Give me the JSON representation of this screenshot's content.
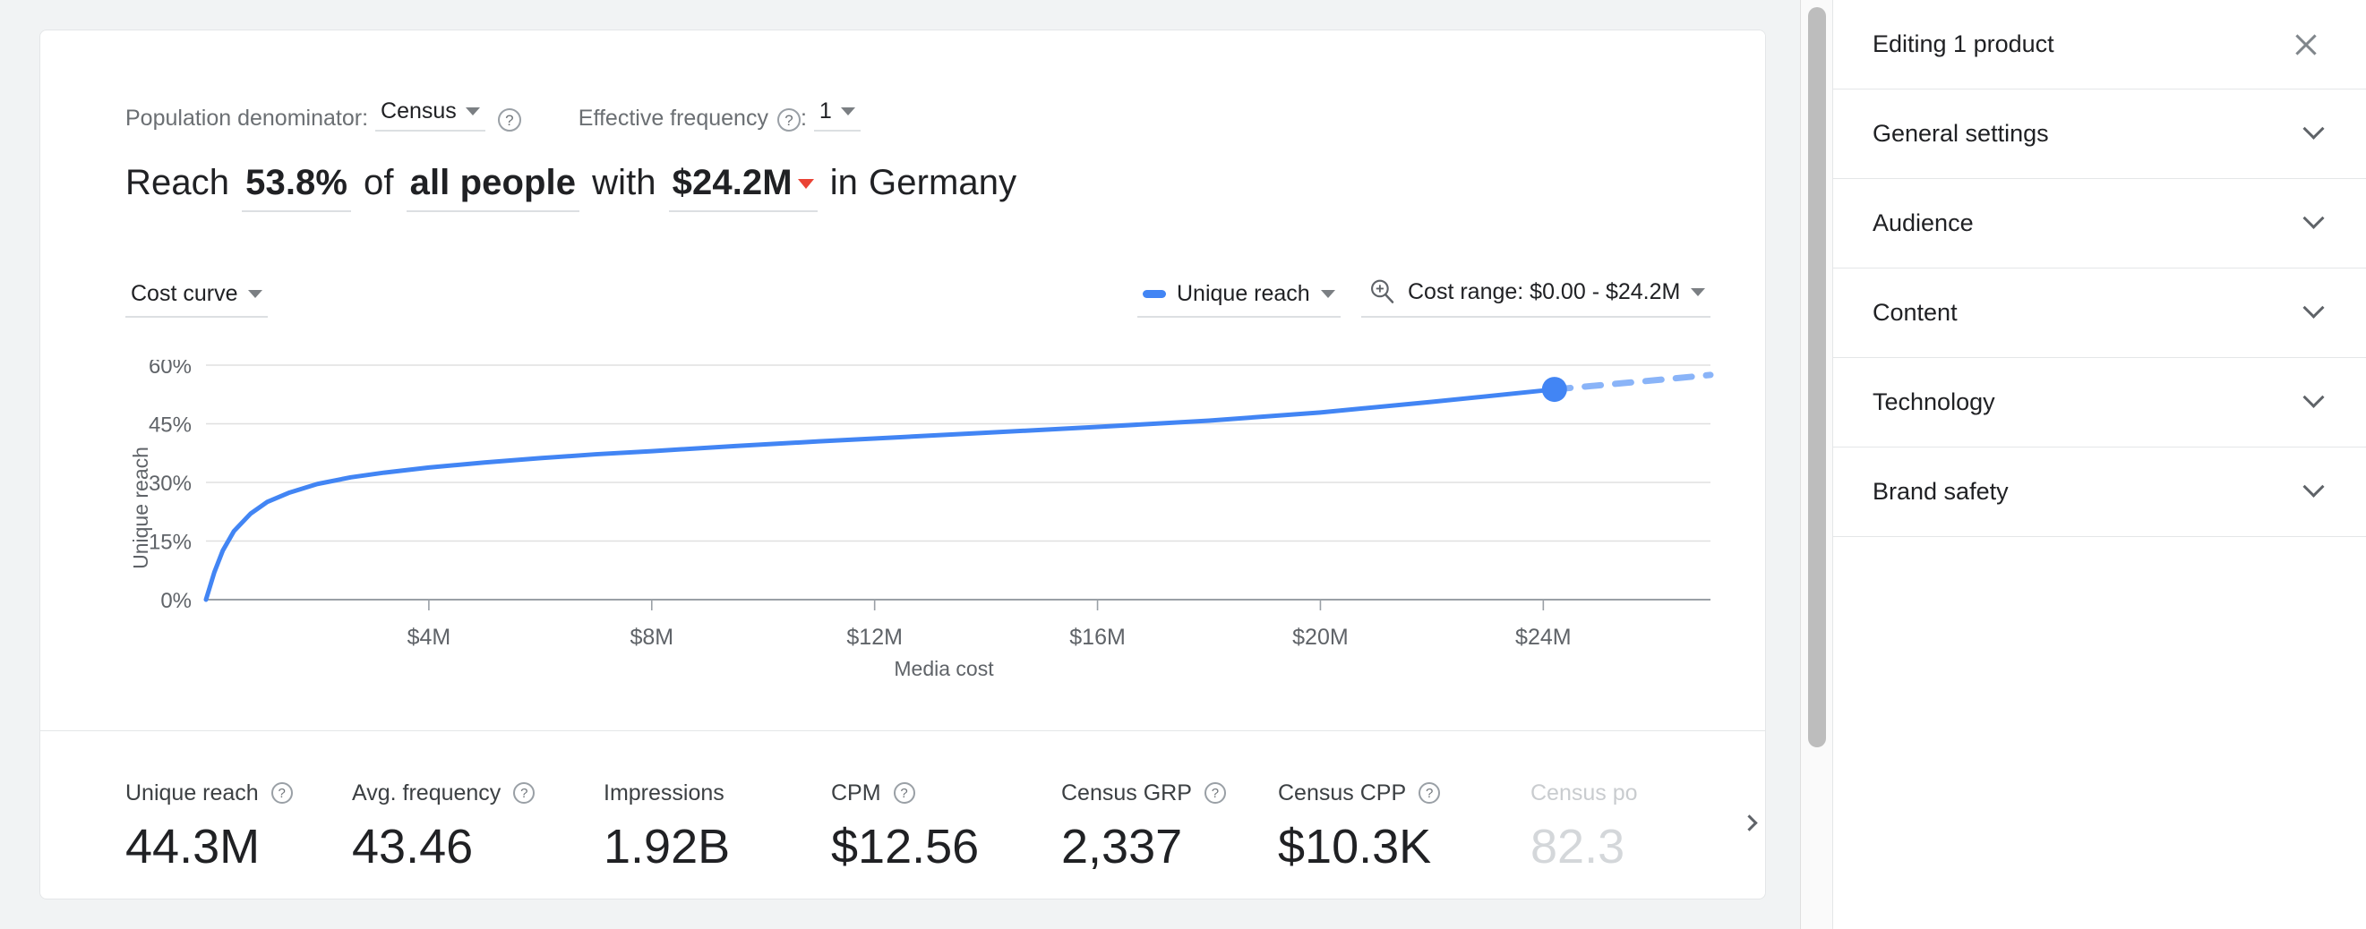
{
  "options": {
    "population_denominator": {
      "label": "Population denominator:",
      "value": "Census",
      "help_icon": "help-circle-icon",
      "caret_icon": "caret-down-icon"
    },
    "effective_frequency": {
      "label": "Effective frequency",
      "separator": ":",
      "value": "1",
      "help_icon": "help-circle-icon",
      "caret_icon": "caret-down-icon"
    }
  },
  "headline": {
    "word_reach": "Reach",
    "reach_percent": "53.8%",
    "word_of": "of",
    "audience": "all people",
    "word_with": "with",
    "budget": "$24.2M",
    "budget_caret_icon": "caret-down-red-icon",
    "word_in": "in",
    "country": "Germany"
  },
  "chart_toolbar": {
    "view_selector": "Cost curve",
    "series_selector": "Unique reach",
    "series_swatch_color": "#4285f4",
    "zoom_icon": "zoom-in-icon",
    "cost_range": "Cost range: $0.00 - $24.2M"
  },
  "chart_data": {
    "type": "line",
    "title": "",
    "xlabel": "Media cost",
    "ylabel": "Unique reach",
    "xlim": [
      0,
      27000000
    ],
    "ylim": [
      0,
      60
    ],
    "grid": true,
    "legend_position": "top-right",
    "x_ticks": [
      4000000,
      8000000,
      12000000,
      16000000,
      20000000,
      24000000
    ],
    "x_tick_labels": [
      "$4M",
      "$8M",
      "$12M",
      "$16M",
      "$20M",
      "$24M"
    ],
    "y_ticks": [
      0,
      15,
      30,
      45,
      60
    ],
    "y_tick_labels": [
      "0%",
      "15%",
      "30%",
      "45%",
      "60%"
    ],
    "series": [
      {
        "name": "Unique reach",
        "color": "#4285f4",
        "style": "solid",
        "x": [
          0,
          150000,
          300000,
          500000,
          800000,
          1100000,
          1500000,
          2000000,
          2600000,
          3200000,
          4000000,
          5000000,
          6000000,
          7000000,
          8000000,
          9500000,
          11000000,
          12500000,
          14000000,
          16000000,
          18000000,
          20000000,
          22000000,
          24200000
        ],
        "y": [
          0,
          7.0,
          12.5,
          17.5,
          22.0,
          25.0,
          27.4,
          29.6,
          31.3,
          32.5,
          33.8,
          35.1,
          36.2,
          37.2,
          38.0,
          39.3,
          40.5,
          41.6,
          42.7,
          44.2,
          45.8,
          47.9,
          50.6,
          53.8
        ]
      },
      {
        "name": "Unique reach (projected)",
        "color": "#8ab4f8",
        "style": "dashed",
        "x": [
          24200000,
          25200000,
          26200000,
          27000000
        ],
        "y": [
          53.8,
          55.1,
          56.4,
          57.5
        ]
      }
    ],
    "marker": {
      "x": 24200000,
      "y": 53.8,
      "color": "#4285f4",
      "radius": 14
    }
  },
  "metrics": [
    {
      "label": "Unique reach",
      "value": "44.3M",
      "has_help": true,
      "faded": false
    },
    {
      "label": "Avg. frequency",
      "value": "43.46",
      "has_help": true,
      "faded": false
    },
    {
      "label": "Impressions",
      "value": "1.92B",
      "has_help": false,
      "faded": false
    },
    {
      "label": "CPM",
      "value": "$12.56",
      "has_help": true,
      "faded": false
    },
    {
      "label": "Census GRP",
      "value": "2,337",
      "has_help": true,
      "faded": false
    },
    {
      "label": "Census CPP",
      "value": "$10.3K",
      "has_help": true,
      "faded": false
    },
    {
      "label": "Census po",
      "value": "82.3",
      "has_help": false,
      "faded": true
    }
  ],
  "metrics_scroll_icon": "chevron-right-icon",
  "side_panel": {
    "header": {
      "title": "Editing 1 product",
      "close_icon": "close-icon"
    },
    "sections": [
      {
        "title": "General settings",
        "chevron_icon": "chevron-down-icon"
      },
      {
        "title": "Audience",
        "chevron_icon": "chevron-down-icon"
      },
      {
        "title": "Content",
        "chevron_icon": "chevron-down-icon"
      },
      {
        "title": "Technology",
        "chevron_icon": "chevron-down-icon"
      },
      {
        "title": "Brand safety",
        "chevron_icon": "chevron-down-icon"
      }
    ]
  },
  "scrollbar": {
    "orientation": "vertical"
  }
}
